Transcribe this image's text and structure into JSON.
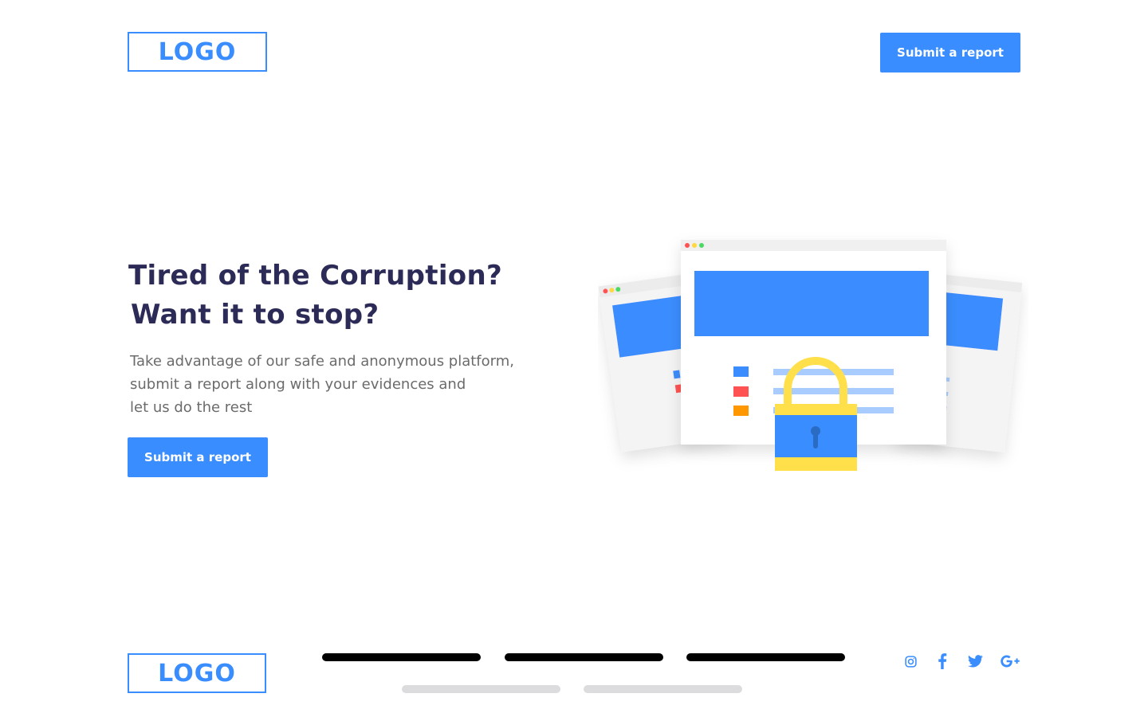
{
  "header": {
    "logo_text": "LOGO",
    "submit_label": "Submit a report"
  },
  "hero": {
    "title_line1": "Tired of the Corruption?",
    "title_line2": "Want it to stop?",
    "description_line1": "Take advantage of our safe and anonymous platform,",
    "description_line2": "submit a report along with your evidences and",
    "description_line3": "let us do the rest",
    "submit_label": "Submit a report"
  },
  "footer": {
    "logo_text": "LOGO",
    "social_icons": [
      "instagram-icon",
      "facebook-icon",
      "twitter-icon",
      "google-plus-icon"
    ]
  },
  "colors": {
    "accent": "#3a8dff",
    "title": "#2c2a56",
    "body_text": "#6b6b6b",
    "lock_yellow": "#ffe04a"
  }
}
